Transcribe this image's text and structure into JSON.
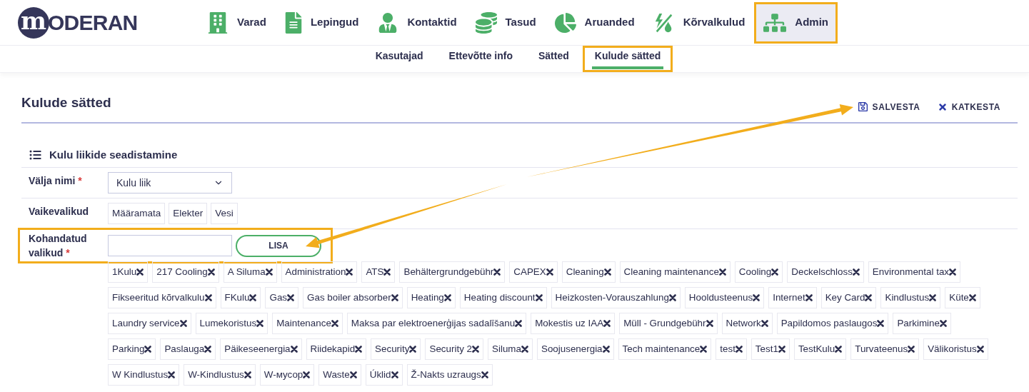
{
  "logo": {
    "initial": "m",
    "text": "ODERAN"
  },
  "nav": [
    {
      "label": "Varad",
      "selected": false,
      "highlighted": false
    },
    {
      "label": "Lepingud",
      "selected": false,
      "highlighted": false
    },
    {
      "label": "Kontaktid",
      "selected": false,
      "highlighted": false
    },
    {
      "label": "Tasud",
      "selected": false,
      "highlighted": false
    },
    {
      "label": "Aruanded",
      "selected": false,
      "highlighted": false
    },
    {
      "label": "Kõrvalkulud",
      "selected": false,
      "highlighted": false
    },
    {
      "label": "Admin",
      "selected": true,
      "highlighted": true
    }
  ],
  "subnav": [
    {
      "label": "Kasutajad",
      "selected": false,
      "highlighted": false
    },
    {
      "label": "Ettevõtte info",
      "selected": false,
      "highlighted": false
    },
    {
      "label": "Sätted",
      "selected": false,
      "highlighted": false
    },
    {
      "label": "Kulude sätted",
      "selected": true,
      "highlighted": true
    }
  ],
  "page_title": "Kulude sätted",
  "actions": [
    {
      "kind": "save",
      "label": "SALVESTA"
    },
    {
      "kind": "cancel",
      "label": "KATKESTA"
    }
  ],
  "section_title": "Kulu liikide seadistamine",
  "field_name": {
    "label": "Välja nimi",
    "required_mark": "*",
    "value": "Kulu liik"
  },
  "defaults": {
    "label": "Vaikevalikud",
    "options": [
      "Määramata",
      "Elekter",
      "Vesi"
    ]
  },
  "custom": {
    "label": "Kohandatud valikud",
    "required_mark": "*",
    "highlighted": true,
    "button": "LISA",
    "tags": [
      "1Kulu",
      "217 Cooling",
      "A Siluma",
      "Administration",
      "ATS",
      "Behältergrundgebühr",
      "CAPEX",
      "Cleaning",
      "Cleaning maintenance",
      "Cooling",
      "Deckelschloss",
      "Environmental tax",
      "Fikseeritud kõrvalkulu",
      "FKulu",
      "Gas",
      "Gas boiler absorber",
      "Heating",
      "Heating discount",
      "Heizkosten-Vorauszahlung",
      "Hooldusteenus",
      "Internet",
      "Key Card",
      "Kindlustus",
      "Küte",
      "Laundry service",
      "Lumekoristus",
      "Maintenance",
      "Maksa par elektroenerģijas sadalīšanu",
      "Mokestis uz IAA",
      "Müll - Grundgebühr",
      "Network",
      "Papildomos paslaugos",
      "Parkimine",
      "Parking",
      "Paslauga",
      "Päikeseenergia",
      "Riidekapid",
      "Security",
      "Security 2",
      "Siluma",
      "Soojusenergia",
      "Tech maintenance",
      "test",
      "Test1",
      "TestKulu",
      "Turvateenus",
      "Välikoristus",
      "W Kindlustus",
      "W-Kindlustus",
      "W-мусор",
      "Waste",
      "Úklid",
      "Ž-Nakts uzraugs"
    ]
  },
  "annotations": [
    {
      "kind": "arrow"
    },
    {
      "kind": "arrow"
    }
  ]
}
